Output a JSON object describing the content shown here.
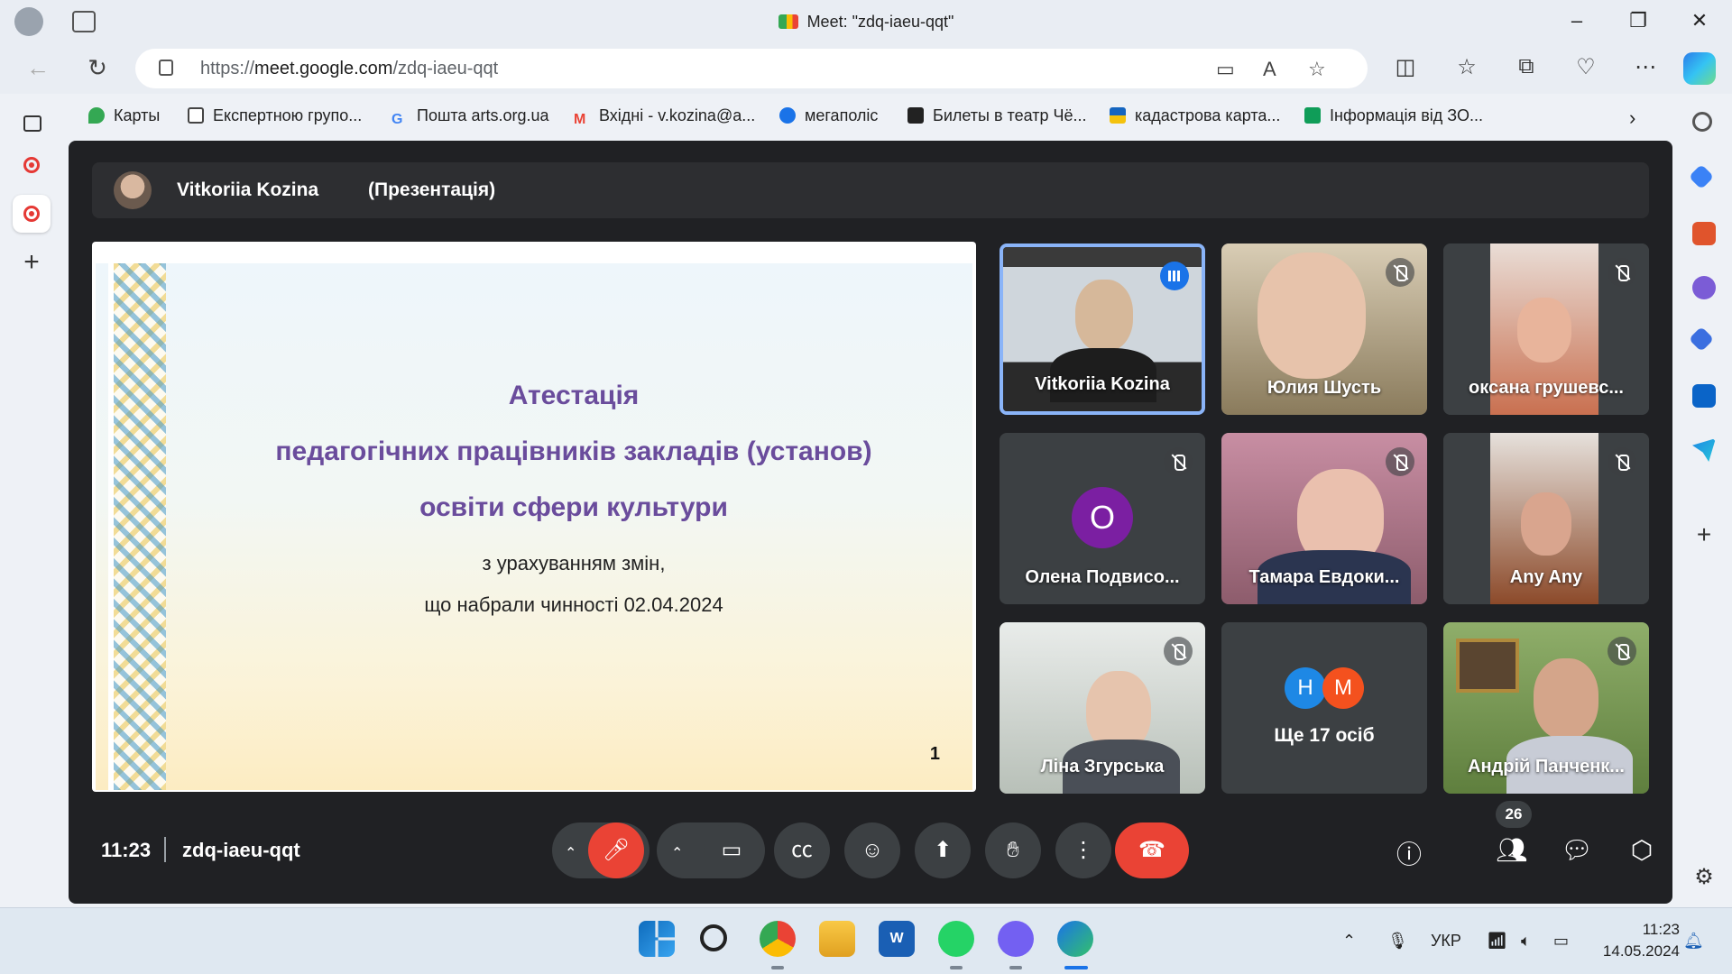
{
  "browser": {
    "window_title": "Meet: \"zdq-iaeu-qqt\"",
    "url_prefix": "https://",
    "url_domain": "meet.google.com",
    "url_path": "/zdq-iaeu-qqt"
  },
  "favorites": [
    {
      "label": "Карты",
      "color": "#34a853"
    },
    {
      "label": "Експертною групо...",
      "color": "#ffffff"
    },
    {
      "label": "Пошта arts.org.ua",
      "color": "#4285f4"
    },
    {
      "label": "Вхідні - v.kozina@a...",
      "color": "#ea4335"
    },
    {
      "label": "мегаполіс",
      "color": "#1a73e8"
    },
    {
      "label": "Билеты в театр Чё...",
      "color": "#222222"
    },
    {
      "label": "кадастрова карта...",
      "color": "#f4c20d"
    },
    {
      "label": "Інформація від ЗО...",
      "color": "#0f9d58"
    }
  ],
  "meet": {
    "presenter_name": "Vitkoriia Kozina",
    "presenter_label": "(Презентація)",
    "slide": {
      "line1": "Атестація",
      "line2": "педагогічних працівників закладів (установ)",
      "line3": "освіти сфери культури",
      "line4": "з урахуванням змін,",
      "line5": "що набрали чинності 02.04.2024",
      "page": "1"
    },
    "participants": [
      {
        "name": "Vitkoriia Kozina",
        "state": "speaking"
      },
      {
        "name": "Юлия Шусть",
        "state": "muted"
      },
      {
        "name": "оксана грушевс...",
        "state": "muted"
      },
      {
        "name": "Олена Подвисо...",
        "state": "muted",
        "initial": "О"
      },
      {
        "name": "Тамара Евдоки...",
        "state": "muted"
      },
      {
        "name": "Any Any",
        "state": "muted"
      },
      {
        "name": "Ліна Згурська",
        "state": "muted"
      },
      {
        "name": "Андрій Панченк...",
        "state": "muted"
      }
    ],
    "others": {
      "text": "Ще 17 осіб",
      "initial1": "Н",
      "initial2": "М"
    },
    "time": "11:23",
    "meeting_code": "zdq-iaeu-qqt",
    "people_count": "26",
    "colors": {
      "end_call": "#ea4335",
      "mic_off": "#ea4335",
      "active_border": "#8ab4f8"
    }
  },
  "taskbar": {
    "language": "УКР",
    "time": "11:23",
    "date": "14.05.2024"
  }
}
